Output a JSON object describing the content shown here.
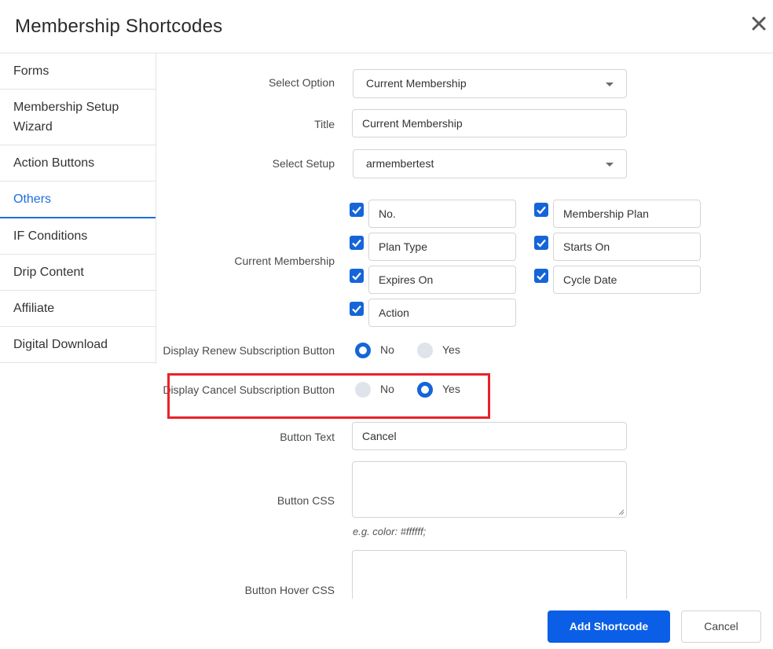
{
  "dialog": {
    "title": "Membership Shortcodes",
    "close_icon": "close-icon"
  },
  "sidebar": {
    "items": [
      {
        "label": "Forms"
      },
      {
        "label": "Membership Setup Wizard"
      },
      {
        "label": "Action Buttons"
      },
      {
        "label": "Others",
        "active": true
      },
      {
        "label": "IF Conditions"
      },
      {
        "label": "Drip Content"
      },
      {
        "label": "Affiliate"
      },
      {
        "label": "Digital Download"
      }
    ]
  },
  "form": {
    "select_option": {
      "label": "Select Option",
      "value": "Current Membership"
    },
    "title": {
      "label": "Title",
      "value": "Current Membership"
    },
    "select_setup": {
      "label": "Select Setup",
      "value": "armembertest"
    },
    "current_membership": {
      "label": "Current Membership",
      "fields": [
        {
          "label": "No.",
          "checked": true
        },
        {
          "label": "Membership Plan",
          "checked": true
        },
        {
          "label": "Plan Type",
          "checked": true
        },
        {
          "label": "Starts On",
          "checked": true
        },
        {
          "label": "Expires On",
          "checked": true
        },
        {
          "label": "Cycle Date",
          "checked": true
        },
        {
          "label": "Action",
          "checked": true
        }
      ]
    },
    "renew": {
      "label": "Display Renew Subscription Button",
      "options": [
        {
          "label": "No",
          "selected": true
        },
        {
          "label": "Yes",
          "selected": false
        }
      ]
    },
    "cancel": {
      "label": "Display Cancel Subscription Button",
      "options": [
        {
          "label": "No",
          "selected": false
        },
        {
          "label": "Yes",
          "selected": true
        }
      ]
    },
    "button_text": {
      "label": "Button Text",
      "value": "Cancel"
    },
    "button_css": {
      "label": "Button CSS",
      "value": "",
      "hint": "e.g. color: #ffffff;"
    },
    "button_hover_css": {
      "label": "Button Hover CSS",
      "value": ""
    }
  },
  "footer": {
    "add_label": "Add Shortcode",
    "cancel_label": "Cancel"
  },
  "colors": {
    "accent": "#1565d8",
    "primary_button": "#0b5ee6",
    "highlight_border": "#e8222a"
  }
}
